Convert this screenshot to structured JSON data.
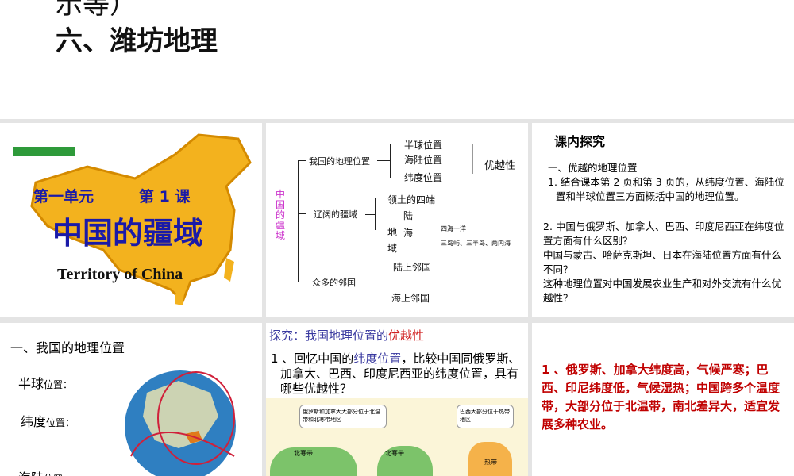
{
  "header": {
    "fragment": "示等）",
    "title": "六、潍坊地理"
  },
  "slide1": {
    "unit": "第一单元",
    "lesson": "第 1 课",
    "title": "中国的疆域",
    "subtitle": "Territory of  China"
  },
  "slide2": {
    "root": "中国的疆域",
    "branches": [
      {
        "label": "我国的地理位置",
        "children": [
          "半球位置",
          "海陆位置",
          "纬度位置"
        ],
        "note": "优越性"
      },
      {
        "label": "辽阔的疆域",
        "children": [
          "领土的四端",
          "陆",
          "海"
        ],
        "extra": "地域",
        "notes": [
          "四海一洋",
          "三岛屿、三半岛、两内海"
        ]
      },
      {
        "label": "众多的邻国",
        "children": [
          "陆上邻国",
          "海上邻国"
        ]
      }
    ]
  },
  "slide3": {
    "heading": "课内探究",
    "subheading": "一、优越的地理位置",
    "q1": "1. 结合课本第 2 页和第 3 页的，从纬度位置、海陆位置和半球位置三方面概括中国的地理位置。",
    "q2": "2. 中国与俄罗斯、加拿大、巴西、印度尼西亚在纬度位置方面有什么区别？",
    "q3": "中国与蒙古、哈萨克斯坦、日本在海陆位置方面有什么不同？",
    "q4": "这种地理位置对中国发展农业生产和对外交流有什么优越性？"
  },
  "slide4": {
    "heading": "一、我国的地理位置",
    "items": [
      {
        "big": "半球",
        "small": "位置："
      },
      {
        "big": "纬度",
        "small": "位置："
      },
      {
        "big": "海陆",
        "small": "位置"
      }
    ]
  },
  "slide5": {
    "title_prefix": "探究：我国地理位置的",
    "title_emph": "优越性",
    "q_a": "1 、回忆中国的",
    "q_emph": "纬度位置",
    "q_b": "，比较中国同俄罗斯、加拿大、巴西、印度尼西亚的纬度位置，具有哪些优越性？",
    "callout1": "俄罗斯和加拿大大部分位于北温带和北寒带地区",
    "callout2": "巴西大部分位于热带地区",
    "map_labels": [
      "北寒带",
      "北寒带",
      "热带"
    ]
  },
  "slide6": {
    "answer": "1 、俄罗斯、加拿大纬度高，气候严寒；巴西、印尼纬度低，气候湿热；中国跨多个温度带，大部分位于北温带，南北差异大，适宜发展多种农业。"
  },
  "colors": {
    "title_blue": "#1a1aa8",
    "map_orange": "#f3b21e",
    "answer_red": "#c00000",
    "accent_purple": "#cc33cc"
  }
}
